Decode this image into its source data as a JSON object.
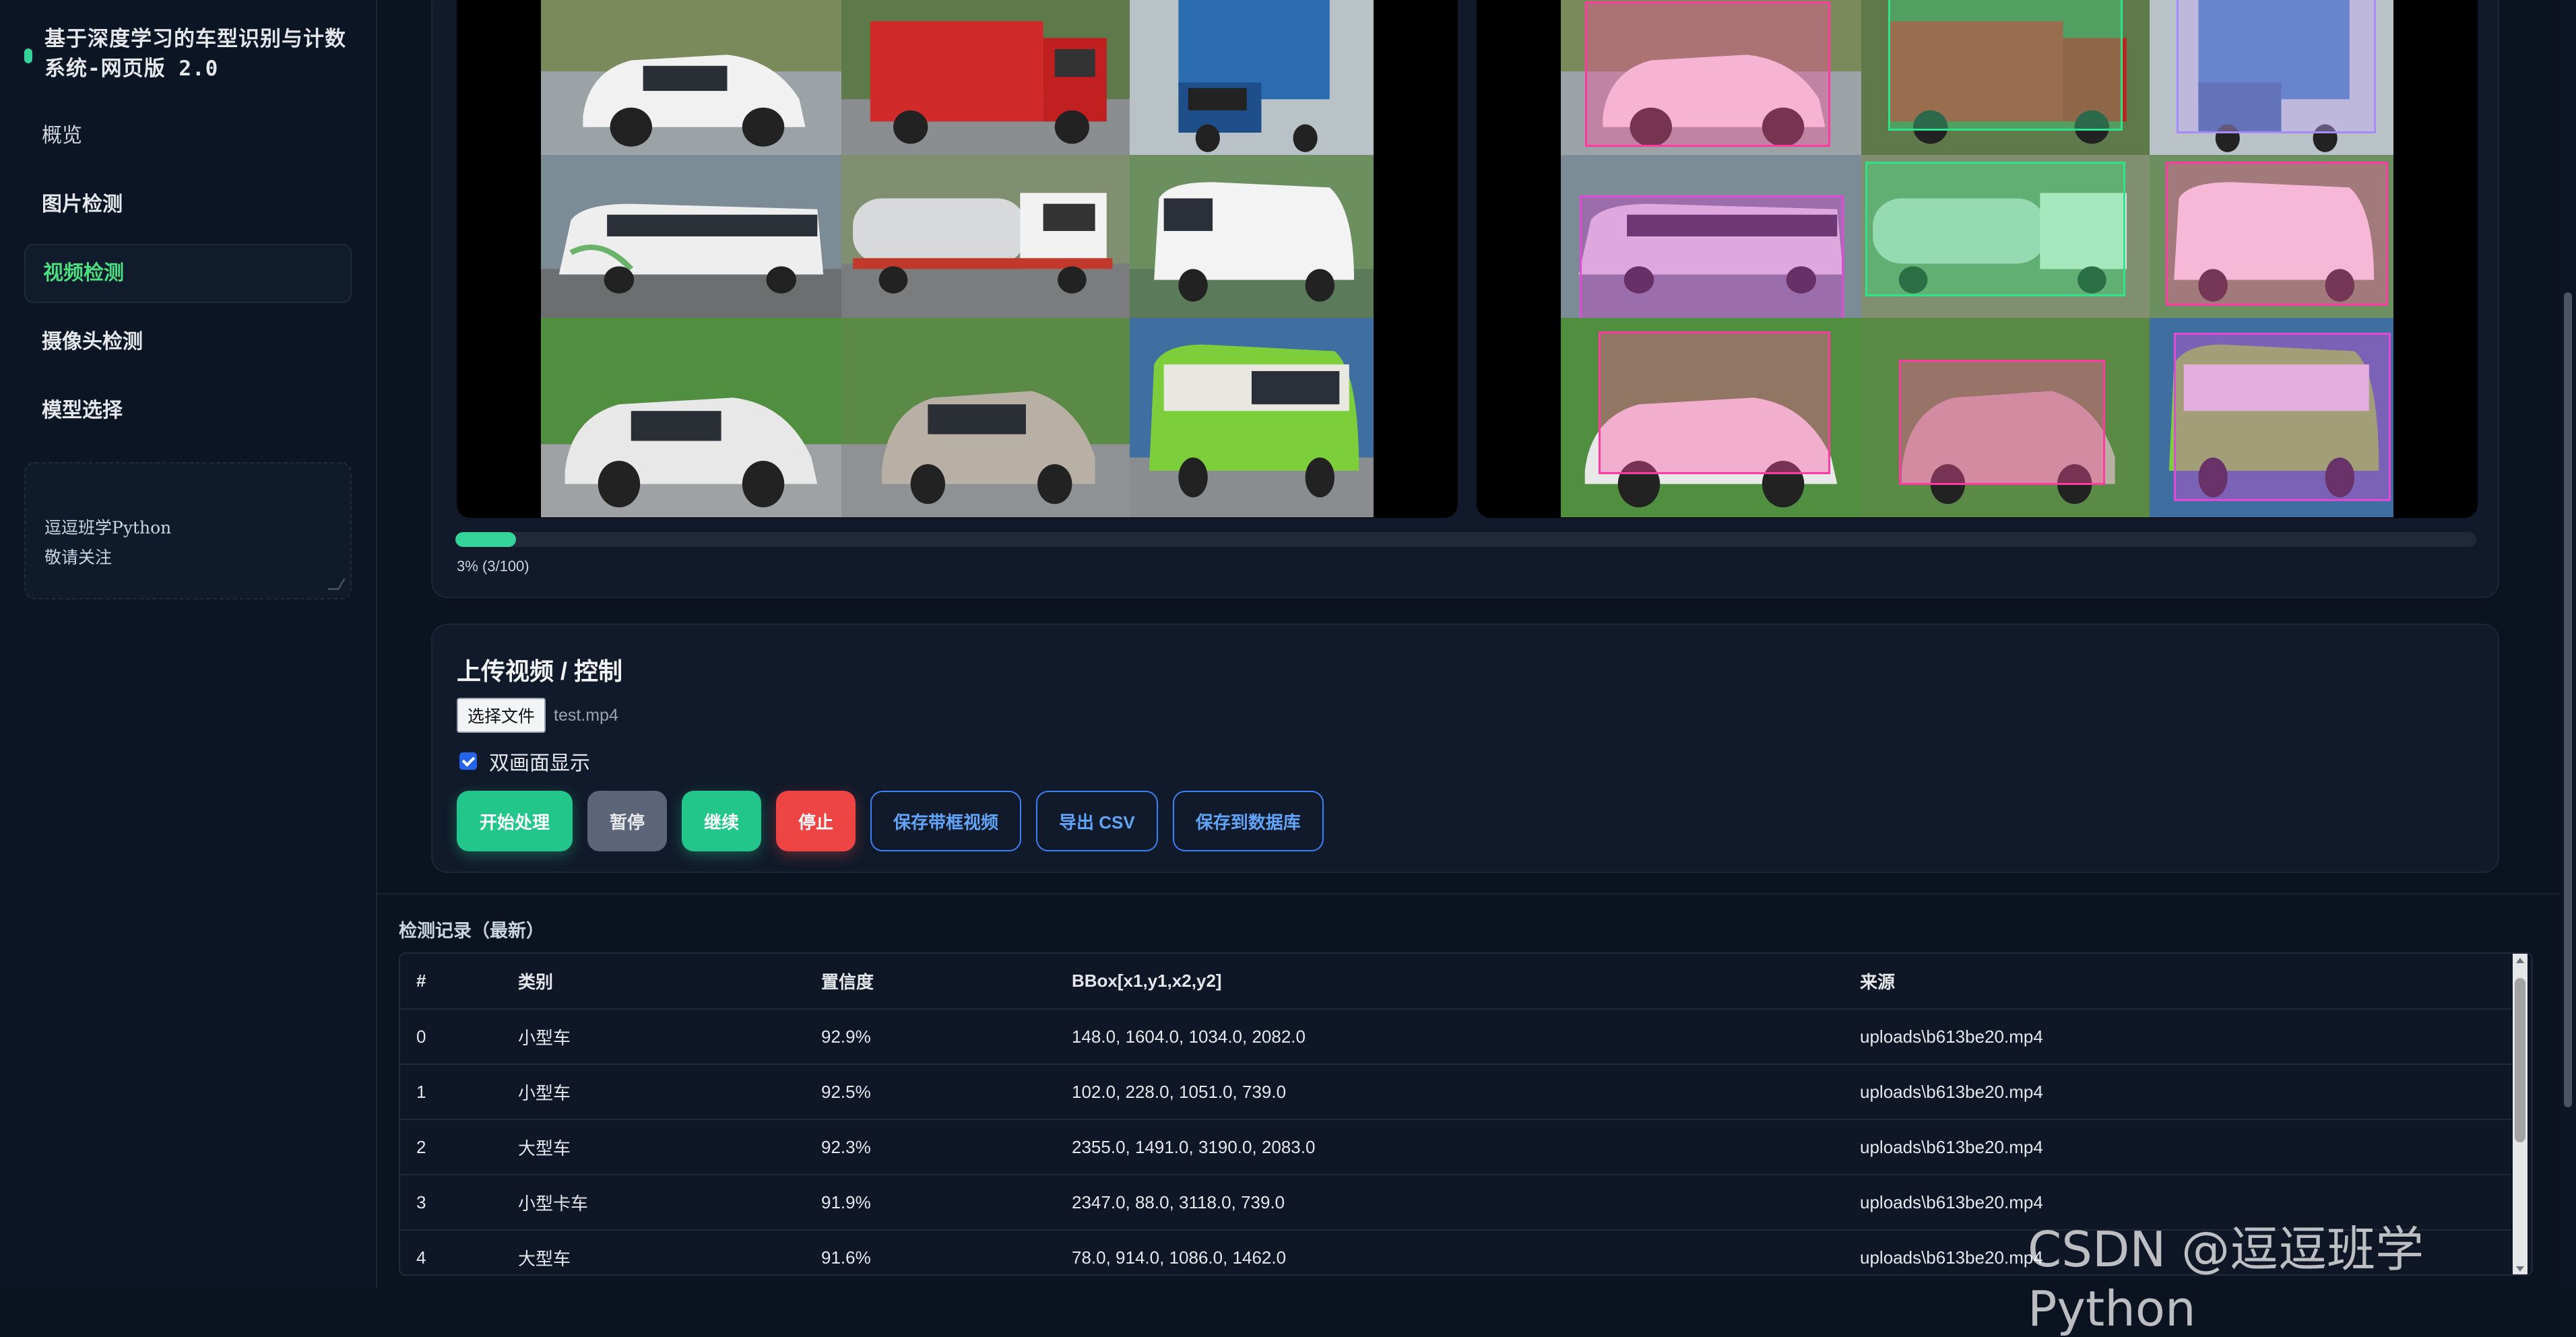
{
  "sidebar": {
    "title": "基于深度学习的车型识别与计数系统-网页版 2.0",
    "items": [
      {
        "label": "概览"
      },
      {
        "label": "图片检测"
      },
      {
        "label": "视频检测"
      },
      {
        "label": "摄像头检测"
      },
      {
        "label": "模型选择"
      }
    ],
    "note": "逗逗班学Python\n敬请关注"
  },
  "video": {
    "progress_percent": 3,
    "progress_label": "3% (3/100)"
  },
  "controls": {
    "title": "上传视频 / 控制",
    "file_button": "选择文件",
    "file_name": "test.mp4",
    "dual_view_label": "双画面显示",
    "buttons": {
      "start": "开始处理",
      "pause": "暂停",
      "resume": "继续",
      "stop": "停止",
      "save_video": "保存带框视频",
      "export_csv": "导出 CSV",
      "save_db": "保存到数据库"
    }
  },
  "records": {
    "title": "检测记录（最新）",
    "columns": [
      "#",
      "类别",
      "置信度",
      "BBox[x1,y1,x2,y2]",
      "来源"
    ],
    "rows": [
      [
        "0",
        "小型车",
        "92.9%",
        "148.0, 1604.0, 1034.0, 2082.0",
        "uploads\\b613be20.mp4"
      ],
      [
        "1",
        "小型车",
        "92.5%",
        "102.0, 228.0, 1051.0, 739.0",
        "uploads\\b613be20.mp4"
      ],
      [
        "2",
        "大型车",
        "92.3%",
        "2355.0, 1491.0, 3190.0, 2083.0",
        "uploads\\b613be20.mp4"
      ],
      [
        "3",
        "小型卡车",
        "91.9%",
        "2347.0, 88.0, 3118.0, 739.0",
        "uploads\\b613be20.mp4"
      ],
      [
        "4",
        "大型车",
        "91.6%",
        "78.0, 914.0, 1086.0, 1462.0",
        "uploads\\b613be20.mp4"
      ]
    ]
  },
  "watermark": "CSDN @逗逗班学Python",
  "colors": {
    "accent": "#34d399",
    "danger": "#ef4444",
    "outline_blue": "#3b82f6",
    "background": "#0b1220"
  }
}
